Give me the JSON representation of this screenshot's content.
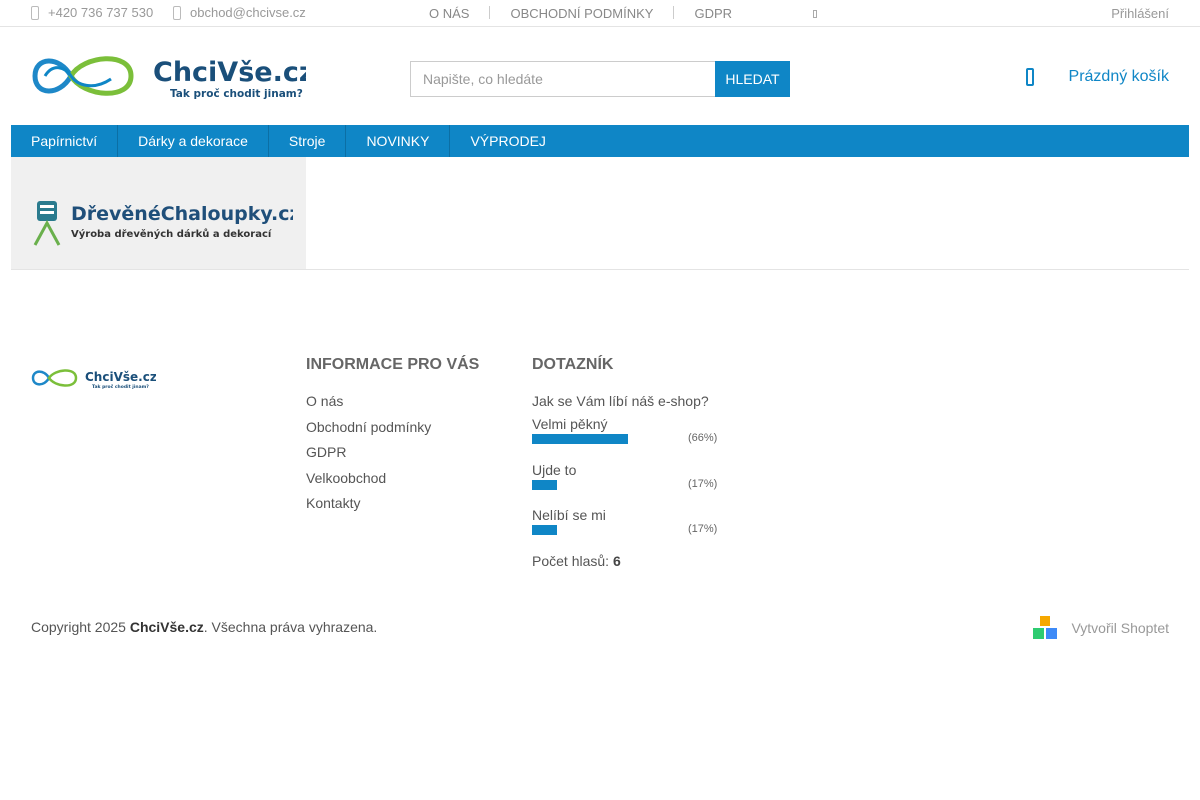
{
  "topbar": {
    "phone": "+420 736 737 530",
    "email": "obchod@chcivse.cz",
    "nav": [
      "O NÁS",
      "OBCHODNÍ PODMÍNKY",
      "GDPR"
    ],
    "login": "Přihlášení"
  },
  "header": {
    "logo_text": "ChciVše.cz",
    "logo_tagline": "Tak proč chodit jinam?",
    "search_placeholder": "Napište, co hledáte",
    "search_button": "HLEDAT",
    "cart_label": "Prázdný košík"
  },
  "mainnav": [
    "Papírnictví",
    "Dárky a dekorace",
    "Stroje",
    "NOVINKY",
    "VÝPRODEJ"
  ],
  "banner": {
    "title": "DřevěnéChaloupky.cz",
    "subtitle": "Výroba dřevěných dárků a dekorací"
  },
  "footer": {
    "logo_text": "ChciVše.cz",
    "logo_tagline": "Tak proč chodit jinam?",
    "info_title": "INFORMACE PRO VÁS",
    "info_links": [
      "O nás",
      "Obchodní podmínky",
      "GDPR",
      "Velkoobchod",
      "Kontakty"
    ],
    "poll": {
      "title": "DOTAZNÍK",
      "question": "Jak se Vám líbí náš e-shop?",
      "answers": [
        {
          "label": "Velmi pěkný",
          "percent": 66,
          "percent_text": "(66%)"
        },
        {
          "label": "Ujde to",
          "percent": 17,
          "percent_text": "(17%)"
        },
        {
          "label": "Nelíbí se mi",
          "percent": 17,
          "percent_text": "(17%)"
        }
      ],
      "votes_label": "Počet hlasů:",
      "votes_count": "6"
    },
    "copyright_prefix": "Copyright 2025",
    "copyright_brand": "ChciVše.cz",
    "copyright_suffix": ". Všechna práva vyhrazena.",
    "shoptet_label": "Vytvořil Shoptet"
  },
  "colors": {
    "accent": "#0f86c6",
    "logo_green": "#7bbf3a",
    "logo_blue": "#1e88c8",
    "logo_dark": "#1a4f7a"
  }
}
